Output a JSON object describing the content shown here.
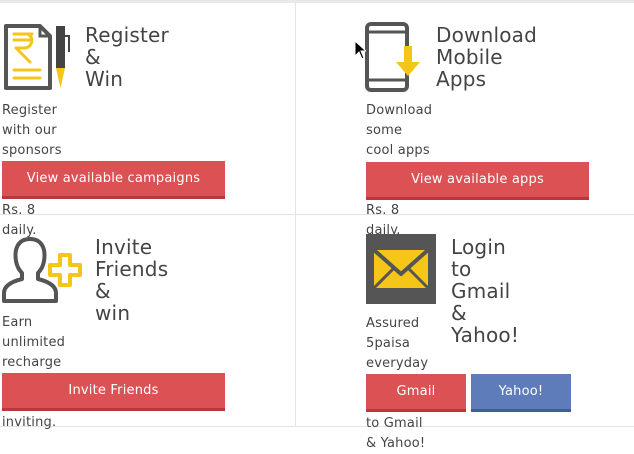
{
  "colors": {
    "accent_red": "#dc5153",
    "accent_blue": "#5d7cb9",
    "icon_yellow": "#f5c518",
    "icon_gray": "#555555"
  },
  "cards": [
    {
      "icon": "rupee-document-pen-icon",
      "title": "Register &\nWin",
      "description": "Register with our sponsors &\nget upto Rs. 8 daily.",
      "button": "View available campaigns"
    },
    {
      "icon": "mobile-download-icon",
      "title": "Download\nMobile Apps",
      "description": "Download some cool apps &\nearn upto Rs. 8 daily.",
      "button": "View available apps"
    },
    {
      "icon": "user-add-icon",
      "title": "Invite\nFriends &\nwin",
      "description": "Earn unlimited recharge\neveryday by inviting.",
      "button": "Invite Friends"
    },
    {
      "icon": "mail-envelope-icon",
      "title": "Login to\nGmail &\nYahoo!",
      "description": "Assured 5paisa everyday when\nyou login to Gmail & Yahoo!",
      "buttons": [
        "Gmail",
        "Yahoo!"
      ]
    }
  ]
}
